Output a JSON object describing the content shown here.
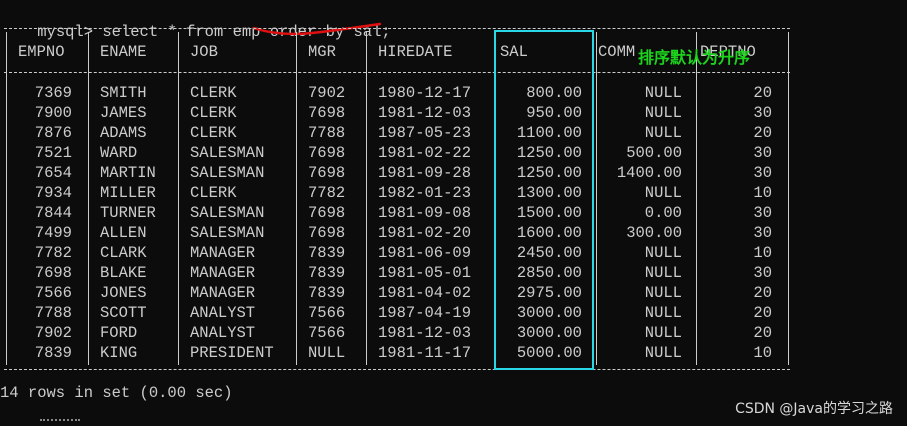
{
  "terminal": {
    "prompt": "mysql>",
    "command": "select * from emp order by sal;",
    "result_summary": "14 rows in set (0.00 sec)"
  },
  "table": {
    "columns": [
      "EMPNO",
      "ENAME",
      "JOB",
      "MGR",
      "HIREDATE",
      "SAL",
      "COMM",
      "DEPTNO"
    ],
    "rows": [
      [
        "7369",
        "SMITH",
        "CLERK",
        "7902",
        "1980-12-17",
        "800.00",
        "NULL",
        "20"
      ],
      [
        "7900",
        "JAMES",
        "CLERK",
        "7698",
        "1981-12-03",
        "950.00",
        "NULL",
        "30"
      ],
      [
        "7876",
        "ADAMS",
        "CLERK",
        "7788",
        "1987-05-23",
        "1100.00",
        "NULL",
        "20"
      ],
      [
        "7521",
        "WARD",
        "SALESMAN",
        "7698",
        "1981-02-22",
        "1250.00",
        "500.00",
        "30"
      ],
      [
        "7654",
        "MARTIN",
        "SALESMAN",
        "7698",
        "1981-09-28",
        "1250.00",
        "1400.00",
        "30"
      ],
      [
        "7934",
        "MILLER",
        "CLERK",
        "7782",
        "1982-01-23",
        "1300.00",
        "NULL",
        "10"
      ],
      [
        "7844",
        "TURNER",
        "SALESMAN",
        "7698",
        "1981-09-08",
        "1500.00",
        "0.00",
        "30"
      ],
      [
        "7499",
        "ALLEN",
        "SALESMAN",
        "7698",
        "1981-02-20",
        "1600.00",
        "300.00",
        "30"
      ],
      [
        "7782",
        "CLARK",
        "MANAGER",
        "7839",
        "1981-06-09",
        "2450.00",
        "NULL",
        "10"
      ],
      [
        "7698",
        "BLAKE",
        "MANAGER",
        "7839",
        "1981-05-01",
        "2850.00",
        "NULL",
        "30"
      ],
      [
        "7566",
        "JONES",
        "MANAGER",
        "7839",
        "1981-04-02",
        "2975.00",
        "NULL",
        "20"
      ],
      [
        "7788",
        "SCOTT",
        "ANALYST",
        "7566",
        "1987-04-19",
        "3000.00",
        "NULL",
        "20"
      ],
      [
        "7902",
        "FORD",
        "ANALYST",
        "7566",
        "1981-12-03",
        "3000.00",
        "NULL",
        "20"
      ],
      [
        "7839",
        "KING",
        "PRESIDENT",
        "NULL",
        "1981-11-17",
        "5000.00",
        "NULL",
        "10"
      ]
    ]
  },
  "annotation": {
    "text": "排序默认为升序",
    "color": "#1cd41c"
  },
  "highlight": {
    "column": "SAL",
    "color": "#2ad7e6"
  },
  "underline_color": "#e01010",
  "watermark": "CSDN @Java的学习之路"
}
